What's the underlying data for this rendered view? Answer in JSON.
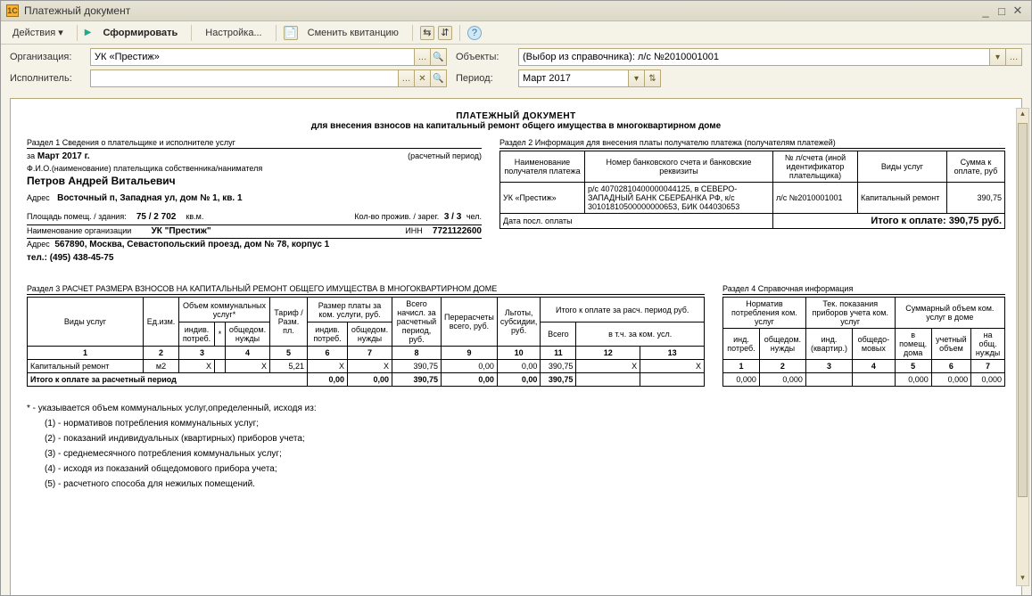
{
  "window": {
    "title": "Платежный документ"
  },
  "toolbar": {
    "actions": "Действия",
    "form": "Сформировать",
    "settings": "Настройка...",
    "change": "Сменить квитанцию"
  },
  "filters": {
    "org_label": "Организация:",
    "org_value": "УК «Престиж»",
    "exec_label": "Исполнитель:",
    "exec_value": "",
    "objects_label": "Объекты:",
    "objects_value": "(Выбор из справочника): л/с №2010001001",
    "period_label": "Период:",
    "period_value": "Март 2017"
  },
  "doc": {
    "title": "ПЛАТЕЖНЫЙ ДОКУМЕНТ",
    "subtitle": "для внесения взносов на капитальный ремонт общего имущества в многоквартирном доме"
  },
  "sec1": {
    "header": "Раздел 1    Сведения о плательщике и исполнителе услуг",
    "period_prefix": "за",
    "period": "Март 2017 г.",
    "period_note": "(расчетный период)",
    "fio_caption": "Ф.И.О.(наименование) плательщика собственника/нанимателя",
    "fio": "Петров Андрей Витальевич",
    "addr_label": "Адрес",
    "addr": "Восточный п, Западная ул, дом № 1, кв. 1",
    "area_label": "Площадь помещ. / здания:",
    "area_val": "75 / 2 702",
    "area_unit": "кв.м.",
    "residents_label": "Кол-во прожив. / зарег.",
    "residents_val": "3 / 3",
    "residents_unit": "чел.",
    "org_label": "Наименование организации",
    "org_val": "УК \"Престиж\"",
    "inn_label": "ИНН",
    "inn_val": "7721122600",
    "addr2_label": "Адрес",
    "addr2": "567890, Москва, Севастопольский проезд, дом № 78, корпус 1",
    "tel_label": "тел.:",
    "tel": "(495) 438-45-75"
  },
  "sec2": {
    "header": "Раздел 2    Информация для внесения платы получателю платежа (получателям платежей)",
    "h1": "Наименование получателя платежа",
    "h2": "Номер банковского счета и банковские реквизиты",
    "h3": "№ л/счета (иной идентификатор плательщика)",
    "h4": "Виды услуг",
    "h5": "Сумма к оплате, руб",
    "c1": "УК «Престиж»",
    "c2": "р/с 40702810400000044125, в СЕВЕРО-ЗАПАДНЫЙ БАНК СБЕРБАНКА РФ, к/с 30101810500000000653, БИК 044030653",
    "c3": "л/с №2010001001",
    "c4": "Капитальный ремонт",
    "c5": "390,75",
    "last_pay": "Дата посл. оплаты",
    "total_label": "Итого к оплате: 390,75 руб."
  },
  "sec3": {
    "header": "Раздел 3    РАСЧЕТ РАЗМЕРА ВЗНОСОВ НА КАПИТАЛЬНЫЙ РЕМОНТ ОБЩЕГО ИМУЩЕСТВА В МНОГОКВАРТИРНОМ ДОМЕ",
    "cols": {
      "c1": "Виды услуг",
      "c2": "Ед.изм.",
      "c3": "Объем коммунальных услуг*",
      "c5": "Тариф / Разм. пл.",
      "c6": "Размер платы за ком. услуги, руб.",
      "c8": "Всего начисл. за расчетный период, руб.",
      "c9": "Перерасчеты всего, руб.",
      "c10": "Льготы, субсидии, руб.",
      "c11": "Итого к оплате за расч. период руб.",
      "sub_ind": "индив. потреб.",
      "sub_star": "*",
      "sub_com": "общедом. нужды",
      "sub_all": "Всего",
      "sub_incl": "в т.ч. за ком. усл."
    },
    "numhdr": [
      "1",
      "2",
      "3",
      "4",
      "5",
      "6",
      "7",
      "8",
      "9",
      "10",
      "11",
      "12",
      "13"
    ],
    "row": {
      "name": "Капитальный ремонт",
      "unit": "м2",
      "v3": "X",
      "v4": "X",
      "tarif": "5,21",
      "v6": "X",
      "v7": "X",
      "v8": "390,75",
      "v9": "0,00",
      "v10": "0,00",
      "v11": "390,75",
      "v12": "X",
      "v13": "X"
    },
    "total_label": "Итого к оплате за расчетный период",
    "total": {
      "v6": "0,00",
      "v7": "0,00",
      "v8": "390,75",
      "v9": "0,00",
      "v10": "0,00",
      "v11": "390,75"
    }
  },
  "sec4": {
    "header": "Раздел 4    Справочная информация",
    "c1": "Норматив потребления ком. услуг",
    "c2": "Тек. показания приборов учета ком. услуг",
    "c3": "Суммарный объем ком. услуг в доме",
    "s1": "инд. потреб.",
    "s2": "общедом. нужды",
    "s3": "инд. (квартир.)",
    "s4": "общедо-мовых",
    "s5": "в помещ. дома",
    "s6": "учетный объем",
    "s7": "на общ. нужды",
    "numhdr": [
      "1",
      "2",
      "3",
      "4",
      "5",
      "6",
      "7"
    ],
    "row": [
      "0,000",
      "0,000",
      "",
      "",
      "0,000",
      "0,000",
      "0,000"
    ]
  },
  "footnotes": {
    "intro": "* - указывается объем коммунальных услуг,определенный, исходя из:",
    "n1": "(1) - нормативов потребления коммунальных услуг;",
    "n2": "(2) - показаний индивидуальных (квартирных) приборов учета;",
    "n3": "(3) - среднемесячного потребления коммунальных услуг;",
    "n4": "(4) - исходя из показаний общедомового прибора учета;",
    "n5": "(5) - расчетного способа для нежилых помещений."
  }
}
